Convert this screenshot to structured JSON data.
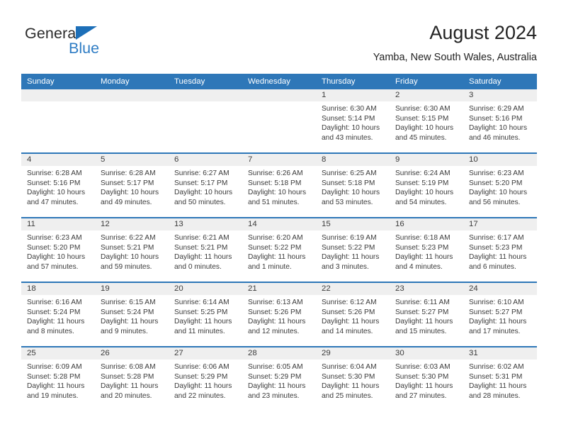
{
  "brand": {
    "name_primary": "General",
    "name_secondary": "Blue",
    "triangle_icon": "triangle-icon",
    "accent_color": "#2e7cc4",
    "logo_dark_color": "#2b2b2b"
  },
  "header": {
    "title": "August 2024",
    "subtitle": "Yamba, New South Wales, Australia"
  },
  "calendar": {
    "header_bg_color": "#2e77b8",
    "day_band_color": "#efefef",
    "row_line_color": "#2e77b8",
    "weekdays": [
      "Sunday",
      "Monday",
      "Tuesday",
      "Wednesday",
      "Thursday",
      "Friday",
      "Saturday"
    ],
    "weeks": [
      [
        {
          "day": "",
          "sunrise": "",
          "sunset": "",
          "daylight_line1": "",
          "daylight_line2": ""
        },
        {
          "day": "",
          "sunrise": "",
          "sunset": "",
          "daylight_line1": "",
          "daylight_line2": ""
        },
        {
          "day": "",
          "sunrise": "",
          "sunset": "",
          "daylight_line1": "",
          "daylight_line2": ""
        },
        {
          "day": "",
          "sunrise": "",
          "sunset": "",
          "daylight_line1": "",
          "daylight_line2": ""
        },
        {
          "day": "1",
          "sunrise": "Sunrise: 6:30 AM",
          "sunset": "Sunset: 5:14 PM",
          "daylight_line1": "Daylight: 10 hours",
          "daylight_line2": "and 43 minutes."
        },
        {
          "day": "2",
          "sunrise": "Sunrise: 6:30 AM",
          "sunset": "Sunset: 5:15 PM",
          "daylight_line1": "Daylight: 10 hours",
          "daylight_line2": "and 45 minutes."
        },
        {
          "day": "3",
          "sunrise": "Sunrise: 6:29 AM",
          "sunset": "Sunset: 5:16 PM",
          "daylight_line1": "Daylight: 10 hours",
          "daylight_line2": "and 46 minutes."
        }
      ],
      [
        {
          "day": "4",
          "sunrise": "Sunrise: 6:28 AM",
          "sunset": "Sunset: 5:16 PM",
          "daylight_line1": "Daylight: 10 hours",
          "daylight_line2": "and 47 minutes."
        },
        {
          "day": "5",
          "sunrise": "Sunrise: 6:28 AM",
          "sunset": "Sunset: 5:17 PM",
          "daylight_line1": "Daylight: 10 hours",
          "daylight_line2": "and 49 minutes."
        },
        {
          "day": "6",
          "sunrise": "Sunrise: 6:27 AM",
          "sunset": "Sunset: 5:17 PM",
          "daylight_line1": "Daylight: 10 hours",
          "daylight_line2": "and 50 minutes."
        },
        {
          "day": "7",
          "sunrise": "Sunrise: 6:26 AM",
          "sunset": "Sunset: 5:18 PM",
          "daylight_line1": "Daylight: 10 hours",
          "daylight_line2": "and 51 minutes."
        },
        {
          "day": "8",
          "sunrise": "Sunrise: 6:25 AM",
          "sunset": "Sunset: 5:18 PM",
          "daylight_line1": "Daylight: 10 hours",
          "daylight_line2": "and 53 minutes."
        },
        {
          "day": "9",
          "sunrise": "Sunrise: 6:24 AM",
          "sunset": "Sunset: 5:19 PM",
          "daylight_line1": "Daylight: 10 hours",
          "daylight_line2": "and 54 minutes."
        },
        {
          "day": "10",
          "sunrise": "Sunrise: 6:23 AM",
          "sunset": "Sunset: 5:20 PM",
          "daylight_line1": "Daylight: 10 hours",
          "daylight_line2": "and 56 minutes."
        }
      ],
      [
        {
          "day": "11",
          "sunrise": "Sunrise: 6:23 AM",
          "sunset": "Sunset: 5:20 PM",
          "daylight_line1": "Daylight: 10 hours",
          "daylight_line2": "and 57 minutes."
        },
        {
          "day": "12",
          "sunrise": "Sunrise: 6:22 AM",
          "sunset": "Sunset: 5:21 PM",
          "daylight_line1": "Daylight: 10 hours",
          "daylight_line2": "and 59 minutes."
        },
        {
          "day": "13",
          "sunrise": "Sunrise: 6:21 AM",
          "sunset": "Sunset: 5:21 PM",
          "daylight_line1": "Daylight: 11 hours",
          "daylight_line2": "and 0 minutes."
        },
        {
          "day": "14",
          "sunrise": "Sunrise: 6:20 AM",
          "sunset": "Sunset: 5:22 PM",
          "daylight_line1": "Daylight: 11 hours",
          "daylight_line2": "and 1 minute."
        },
        {
          "day": "15",
          "sunrise": "Sunrise: 6:19 AM",
          "sunset": "Sunset: 5:22 PM",
          "daylight_line1": "Daylight: 11 hours",
          "daylight_line2": "and 3 minutes."
        },
        {
          "day": "16",
          "sunrise": "Sunrise: 6:18 AM",
          "sunset": "Sunset: 5:23 PM",
          "daylight_line1": "Daylight: 11 hours",
          "daylight_line2": "and 4 minutes."
        },
        {
          "day": "17",
          "sunrise": "Sunrise: 6:17 AM",
          "sunset": "Sunset: 5:23 PM",
          "daylight_line1": "Daylight: 11 hours",
          "daylight_line2": "and 6 minutes."
        }
      ],
      [
        {
          "day": "18",
          "sunrise": "Sunrise: 6:16 AM",
          "sunset": "Sunset: 5:24 PM",
          "daylight_line1": "Daylight: 11 hours",
          "daylight_line2": "and 8 minutes."
        },
        {
          "day": "19",
          "sunrise": "Sunrise: 6:15 AM",
          "sunset": "Sunset: 5:24 PM",
          "daylight_line1": "Daylight: 11 hours",
          "daylight_line2": "and 9 minutes."
        },
        {
          "day": "20",
          "sunrise": "Sunrise: 6:14 AM",
          "sunset": "Sunset: 5:25 PM",
          "daylight_line1": "Daylight: 11 hours",
          "daylight_line2": "and 11 minutes."
        },
        {
          "day": "21",
          "sunrise": "Sunrise: 6:13 AM",
          "sunset": "Sunset: 5:26 PM",
          "daylight_line1": "Daylight: 11 hours",
          "daylight_line2": "and 12 minutes."
        },
        {
          "day": "22",
          "sunrise": "Sunrise: 6:12 AM",
          "sunset": "Sunset: 5:26 PM",
          "daylight_line1": "Daylight: 11 hours",
          "daylight_line2": "and 14 minutes."
        },
        {
          "day": "23",
          "sunrise": "Sunrise: 6:11 AM",
          "sunset": "Sunset: 5:27 PM",
          "daylight_line1": "Daylight: 11 hours",
          "daylight_line2": "and 15 minutes."
        },
        {
          "day": "24",
          "sunrise": "Sunrise: 6:10 AM",
          "sunset": "Sunset: 5:27 PM",
          "daylight_line1": "Daylight: 11 hours",
          "daylight_line2": "and 17 minutes."
        }
      ],
      [
        {
          "day": "25",
          "sunrise": "Sunrise: 6:09 AM",
          "sunset": "Sunset: 5:28 PM",
          "daylight_line1": "Daylight: 11 hours",
          "daylight_line2": "and 19 minutes."
        },
        {
          "day": "26",
          "sunrise": "Sunrise: 6:08 AM",
          "sunset": "Sunset: 5:28 PM",
          "daylight_line1": "Daylight: 11 hours",
          "daylight_line2": "and 20 minutes."
        },
        {
          "day": "27",
          "sunrise": "Sunrise: 6:06 AM",
          "sunset": "Sunset: 5:29 PM",
          "daylight_line1": "Daylight: 11 hours",
          "daylight_line2": "and 22 minutes."
        },
        {
          "day": "28",
          "sunrise": "Sunrise: 6:05 AM",
          "sunset": "Sunset: 5:29 PM",
          "daylight_line1": "Daylight: 11 hours",
          "daylight_line2": "and 23 minutes."
        },
        {
          "day": "29",
          "sunrise": "Sunrise: 6:04 AM",
          "sunset": "Sunset: 5:30 PM",
          "daylight_line1": "Daylight: 11 hours",
          "daylight_line2": "and 25 minutes."
        },
        {
          "day": "30",
          "sunrise": "Sunrise: 6:03 AM",
          "sunset": "Sunset: 5:30 PM",
          "daylight_line1": "Daylight: 11 hours",
          "daylight_line2": "and 27 minutes."
        },
        {
          "day": "31",
          "sunrise": "Sunrise: 6:02 AM",
          "sunset": "Sunset: 5:31 PM",
          "daylight_line1": "Daylight: 11 hours",
          "daylight_line2": "and 28 minutes."
        }
      ]
    ]
  }
}
